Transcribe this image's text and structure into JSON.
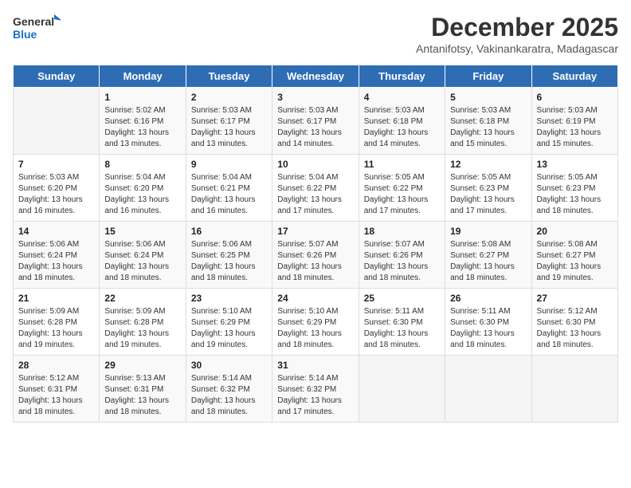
{
  "logo": {
    "line1": "General",
    "line2": "Blue"
  },
  "header": {
    "month": "December 2025",
    "location": "Antanifotsy, Vakinankaratra, Madagascar"
  },
  "days_of_week": [
    "Sunday",
    "Monday",
    "Tuesday",
    "Wednesday",
    "Thursday",
    "Friday",
    "Saturday"
  ],
  "weeks": [
    [
      {
        "day": "",
        "info": ""
      },
      {
        "day": "1",
        "info": "Sunrise: 5:02 AM\nSunset: 6:16 PM\nDaylight: 13 hours\nand 13 minutes."
      },
      {
        "day": "2",
        "info": "Sunrise: 5:03 AM\nSunset: 6:17 PM\nDaylight: 13 hours\nand 13 minutes."
      },
      {
        "day": "3",
        "info": "Sunrise: 5:03 AM\nSunset: 6:17 PM\nDaylight: 13 hours\nand 14 minutes."
      },
      {
        "day": "4",
        "info": "Sunrise: 5:03 AM\nSunset: 6:18 PM\nDaylight: 13 hours\nand 14 minutes."
      },
      {
        "day": "5",
        "info": "Sunrise: 5:03 AM\nSunset: 6:18 PM\nDaylight: 13 hours\nand 15 minutes."
      },
      {
        "day": "6",
        "info": "Sunrise: 5:03 AM\nSunset: 6:19 PM\nDaylight: 13 hours\nand 15 minutes."
      }
    ],
    [
      {
        "day": "7",
        "info": "Sunrise: 5:03 AM\nSunset: 6:20 PM\nDaylight: 13 hours\nand 16 minutes."
      },
      {
        "day": "8",
        "info": "Sunrise: 5:04 AM\nSunset: 6:20 PM\nDaylight: 13 hours\nand 16 minutes."
      },
      {
        "day": "9",
        "info": "Sunrise: 5:04 AM\nSunset: 6:21 PM\nDaylight: 13 hours\nand 16 minutes."
      },
      {
        "day": "10",
        "info": "Sunrise: 5:04 AM\nSunset: 6:22 PM\nDaylight: 13 hours\nand 17 minutes."
      },
      {
        "day": "11",
        "info": "Sunrise: 5:05 AM\nSunset: 6:22 PM\nDaylight: 13 hours\nand 17 minutes."
      },
      {
        "day": "12",
        "info": "Sunrise: 5:05 AM\nSunset: 6:23 PM\nDaylight: 13 hours\nand 17 minutes."
      },
      {
        "day": "13",
        "info": "Sunrise: 5:05 AM\nSunset: 6:23 PM\nDaylight: 13 hours\nand 18 minutes."
      }
    ],
    [
      {
        "day": "14",
        "info": "Sunrise: 5:06 AM\nSunset: 6:24 PM\nDaylight: 13 hours\nand 18 minutes."
      },
      {
        "day": "15",
        "info": "Sunrise: 5:06 AM\nSunset: 6:24 PM\nDaylight: 13 hours\nand 18 minutes."
      },
      {
        "day": "16",
        "info": "Sunrise: 5:06 AM\nSunset: 6:25 PM\nDaylight: 13 hours\nand 18 minutes."
      },
      {
        "day": "17",
        "info": "Sunrise: 5:07 AM\nSunset: 6:26 PM\nDaylight: 13 hours\nand 18 minutes."
      },
      {
        "day": "18",
        "info": "Sunrise: 5:07 AM\nSunset: 6:26 PM\nDaylight: 13 hours\nand 18 minutes."
      },
      {
        "day": "19",
        "info": "Sunrise: 5:08 AM\nSunset: 6:27 PM\nDaylight: 13 hours\nand 18 minutes."
      },
      {
        "day": "20",
        "info": "Sunrise: 5:08 AM\nSunset: 6:27 PM\nDaylight: 13 hours\nand 19 minutes."
      }
    ],
    [
      {
        "day": "21",
        "info": "Sunrise: 5:09 AM\nSunset: 6:28 PM\nDaylight: 13 hours\nand 19 minutes."
      },
      {
        "day": "22",
        "info": "Sunrise: 5:09 AM\nSunset: 6:28 PM\nDaylight: 13 hours\nand 19 minutes."
      },
      {
        "day": "23",
        "info": "Sunrise: 5:10 AM\nSunset: 6:29 PM\nDaylight: 13 hours\nand 19 minutes."
      },
      {
        "day": "24",
        "info": "Sunrise: 5:10 AM\nSunset: 6:29 PM\nDaylight: 13 hours\nand 18 minutes."
      },
      {
        "day": "25",
        "info": "Sunrise: 5:11 AM\nSunset: 6:30 PM\nDaylight: 13 hours\nand 18 minutes."
      },
      {
        "day": "26",
        "info": "Sunrise: 5:11 AM\nSunset: 6:30 PM\nDaylight: 13 hours\nand 18 minutes."
      },
      {
        "day": "27",
        "info": "Sunrise: 5:12 AM\nSunset: 6:30 PM\nDaylight: 13 hours\nand 18 minutes."
      }
    ],
    [
      {
        "day": "28",
        "info": "Sunrise: 5:12 AM\nSunset: 6:31 PM\nDaylight: 13 hours\nand 18 minutes."
      },
      {
        "day": "29",
        "info": "Sunrise: 5:13 AM\nSunset: 6:31 PM\nDaylight: 13 hours\nand 18 minutes."
      },
      {
        "day": "30",
        "info": "Sunrise: 5:14 AM\nSunset: 6:32 PM\nDaylight: 13 hours\nand 18 minutes."
      },
      {
        "day": "31",
        "info": "Sunrise: 5:14 AM\nSunset: 6:32 PM\nDaylight: 13 hours\nand 17 minutes."
      },
      {
        "day": "",
        "info": ""
      },
      {
        "day": "",
        "info": ""
      },
      {
        "day": "",
        "info": ""
      }
    ]
  ]
}
